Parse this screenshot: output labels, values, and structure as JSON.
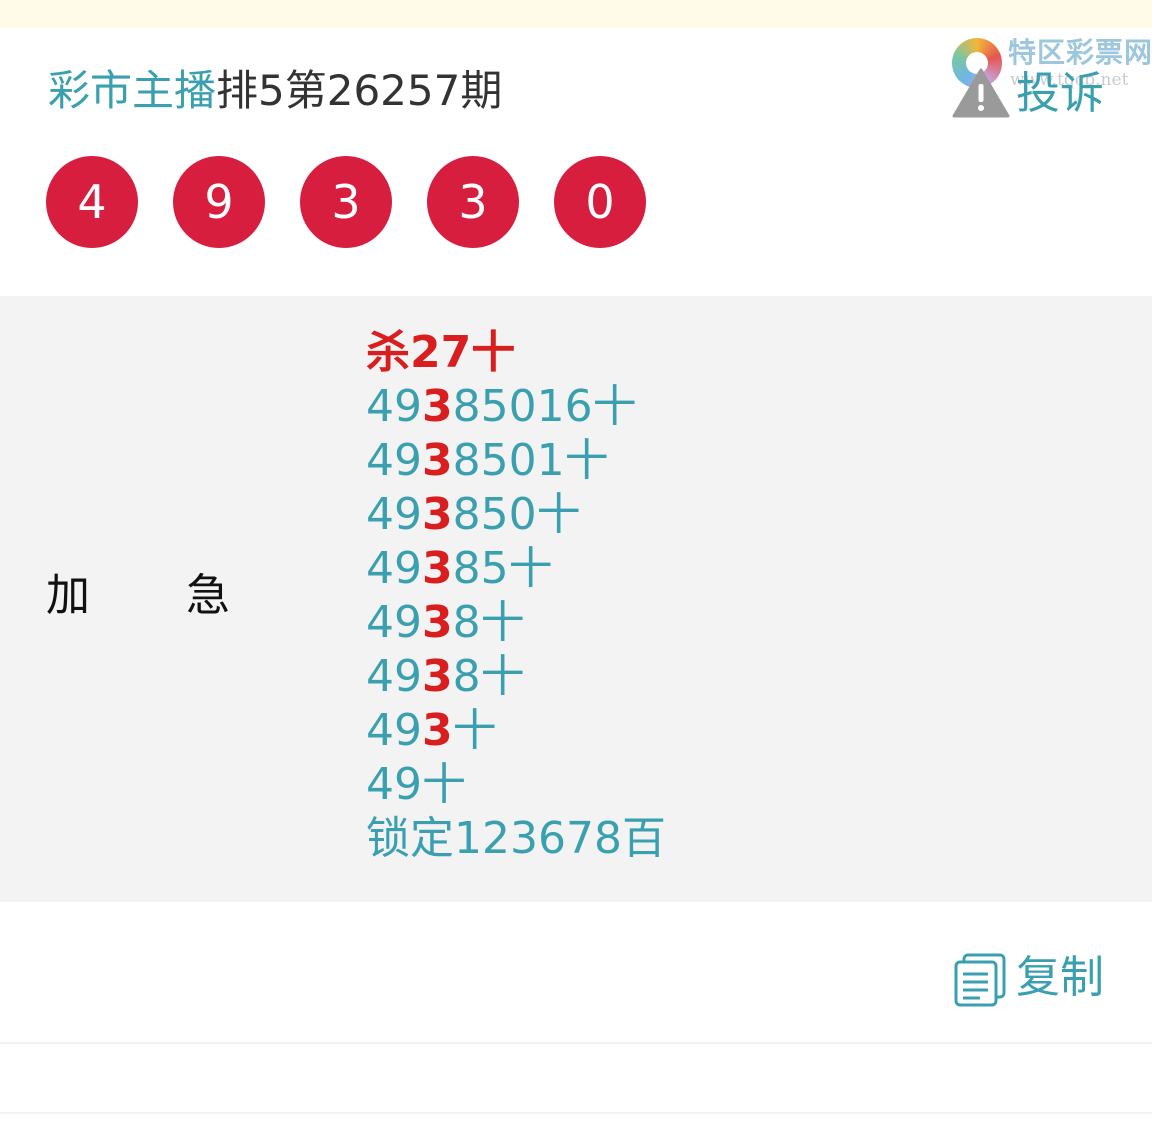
{
  "header": {
    "author": "彩市主播",
    "issue": "排5第26257期",
    "report_label": "投诉",
    "watermark_name": "特区彩票网",
    "watermark_url": "www.tqcp.net"
  },
  "balls": [
    "4",
    "9",
    "3",
    "3",
    "0"
  ],
  "ball_color": "#d81e3f",
  "accent_color": "#3aa0b0",
  "highlight_color": "#d81e1e",
  "content": {
    "label_left": "加",
    "label_right": "急",
    "kill_line": "杀27十",
    "lines": [
      {
        "pre": "49",
        "hl": "3",
        "post": "85016十"
      },
      {
        "pre": "49",
        "hl": "3",
        "post": "8501十"
      },
      {
        "pre": "49",
        "hl": "3",
        "post": "850十"
      },
      {
        "pre": "49",
        "hl": "3",
        "post": "85十"
      },
      {
        "pre": "49",
        "hl": "3",
        "post": "8十"
      },
      {
        "pre": "49",
        "hl": "3",
        "post": "8十"
      },
      {
        "pre": "49",
        "hl": "3",
        "post": "十"
      },
      {
        "pre": "49",
        "hl": "",
        "post": "十"
      },
      {
        "pre": "锁定123678百",
        "hl": "",
        "post": ""
      }
    ]
  },
  "footer": {
    "copy_label": "复制"
  },
  "icons": {
    "report": "warning-triangle-icon",
    "copy": "copy-document-icon",
    "logo": "lottery-logo-icon"
  }
}
